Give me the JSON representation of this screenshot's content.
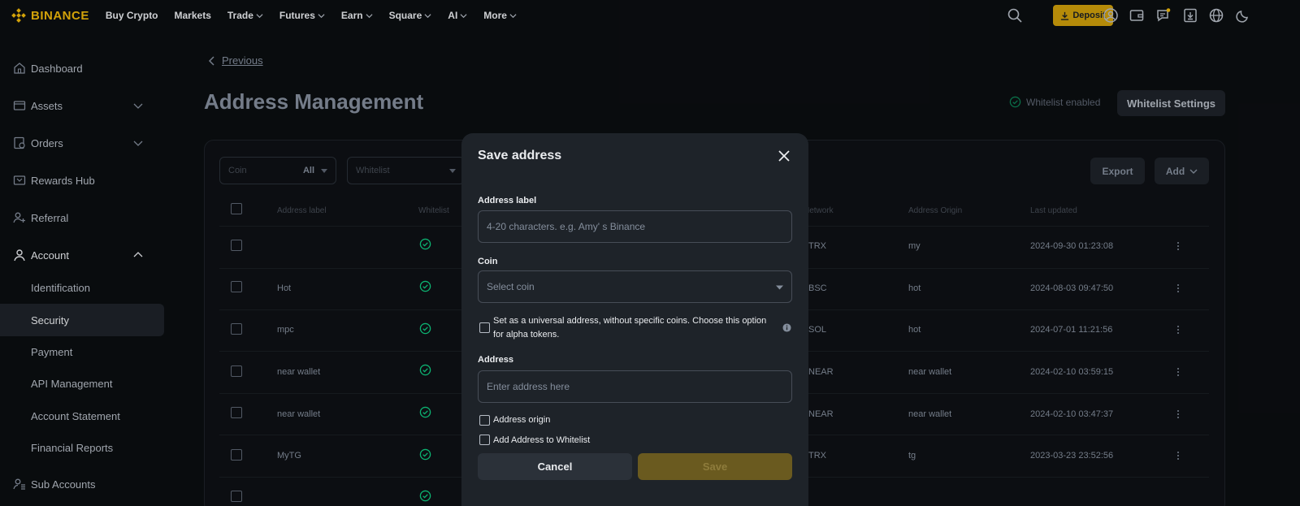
{
  "nav": {
    "logo_text": "BINANCE",
    "items": [
      {
        "label": "Buy Crypto",
        "dropdown": false
      },
      {
        "label": "Markets",
        "dropdown": false
      },
      {
        "label": "Trade",
        "dropdown": true
      },
      {
        "label": "Futures",
        "dropdown": true
      },
      {
        "label": "Earn",
        "dropdown": true
      },
      {
        "label": "Square",
        "dropdown": true
      },
      {
        "label": "AI",
        "dropdown": true
      },
      {
        "label": "More",
        "dropdown": true
      }
    ],
    "deposit_label": "Deposit",
    "icons": [
      "search-icon",
      "download-icon",
      "user-icon",
      "wallet-icon",
      "message-icon",
      "download-app-icon",
      "globe-icon",
      "moon-icon"
    ]
  },
  "sidebar": {
    "items": [
      {
        "label": "Dashboard",
        "icon": "home-icon"
      },
      {
        "label": "Assets",
        "icon": "wallet-icon"
      },
      {
        "label": "Orders",
        "icon": "orders-icon"
      },
      {
        "label": "Rewards Hub",
        "icon": "rewards-icon"
      },
      {
        "label": "Referral",
        "icon": "referral-icon"
      },
      {
        "label": "Account",
        "icon": "user-icon"
      }
    ],
    "account_subitems": [
      "Identification",
      "Security",
      "Payment",
      "API Management",
      "Account Statement",
      "Financial Reports"
    ],
    "active_subitem": "Security",
    "sub_accounts": {
      "label": "Sub Accounts",
      "icon": "sub-accounts-icon"
    }
  },
  "main": {
    "previous_label": "Previous",
    "title": "Address Management",
    "whitelist_status": "Whitelist enabled",
    "whitelist_settings_label": "Whitelist Settings",
    "filters": {
      "coin_label": "Coin",
      "coin_value": "All",
      "whitelist_placeholder": "Whitelist"
    },
    "export_label": "Export",
    "add_label": "Add",
    "table": {
      "headers": {
        "label": "Address label",
        "whitelist": "Whitelist",
        "network": "Network",
        "origin": "Address Origin",
        "updated": "Last updated"
      },
      "rows": [
        {
          "label": "",
          "network": "TRX",
          "origin": "my",
          "updated": "2024-09-30 01:23:08"
        },
        {
          "label": "Hot",
          "network": "BSC",
          "origin": "hot",
          "updated": "2024-08-03 09:47:50"
        },
        {
          "label": "mpc",
          "network": "SOL",
          "origin": "hot",
          "updated": "2024-07-01 11:21:56"
        },
        {
          "label": "near wallet",
          "network": "NEAR",
          "origin": "near wallet",
          "updated": "2024-02-10 03:59:15"
        },
        {
          "label": "near wallet",
          "network": "NEAR",
          "origin": "near wallet",
          "updated": "2024-02-10 03:47:37"
        },
        {
          "label": "MyTG",
          "network": "TRX",
          "origin": "tg",
          "updated": "2023-03-23 23:52:56"
        }
      ]
    }
  },
  "modal": {
    "title": "Save address",
    "address_label_title": "Address label",
    "address_label_placeholder": "4-20 characters. e.g. Amy' s Binance",
    "coin_title": "Coin",
    "coin_placeholder": "Select coin",
    "universal_text": "Set as a universal address, without specific coins. Choose this option for alpha tokens.",
    "address_title": "Address",
    "address_placeholder": "Enter address here",
    "origin_text": "Address origin",
    "whitelist_text": "Add Address to Whitelist",
    "cancel_label": "Cancel",
    "save_label": "Save"
  },
  "colors": {
    "brand": "#f0b90b",
    "success": "#0ecb81",
    "background": "#0b0e11",
    "modal": "#1e2329"
  }
}
